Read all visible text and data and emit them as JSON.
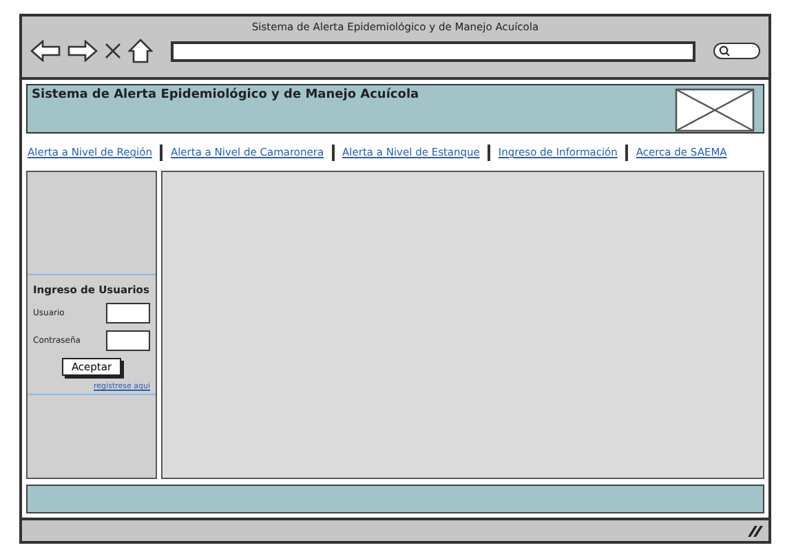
{
  "window": {
    "title": "Sistema de Alerta Epidemiológico y de Manejo Acuícola"
  },
  "header": {
    "title": "Sistema de Alerta Epidemiológico y de Manejo Acuícola"
  },
  "nav": [
    {
      "label": "Alerta a Nivel de Región"
    },
    {
      "label": "Alerta a Nivel de Camaronera"
    },
    {
      "label": "Alerta a Nivel de Estanque"
    },
    {
      "label": "Ingreso de Información"
    },
    {
      "label": "Acerca de SAEMA"
    }
  ],
  "login": {
    "title": "Ingreso de Usuarios",
    "fields": [
      {
        "label": "Usuario"
      },
      {
        "label": "Contraseña"
      }
    ],
    "button": "Aceptar",
    "link": "registrese aqui"
  }
}
